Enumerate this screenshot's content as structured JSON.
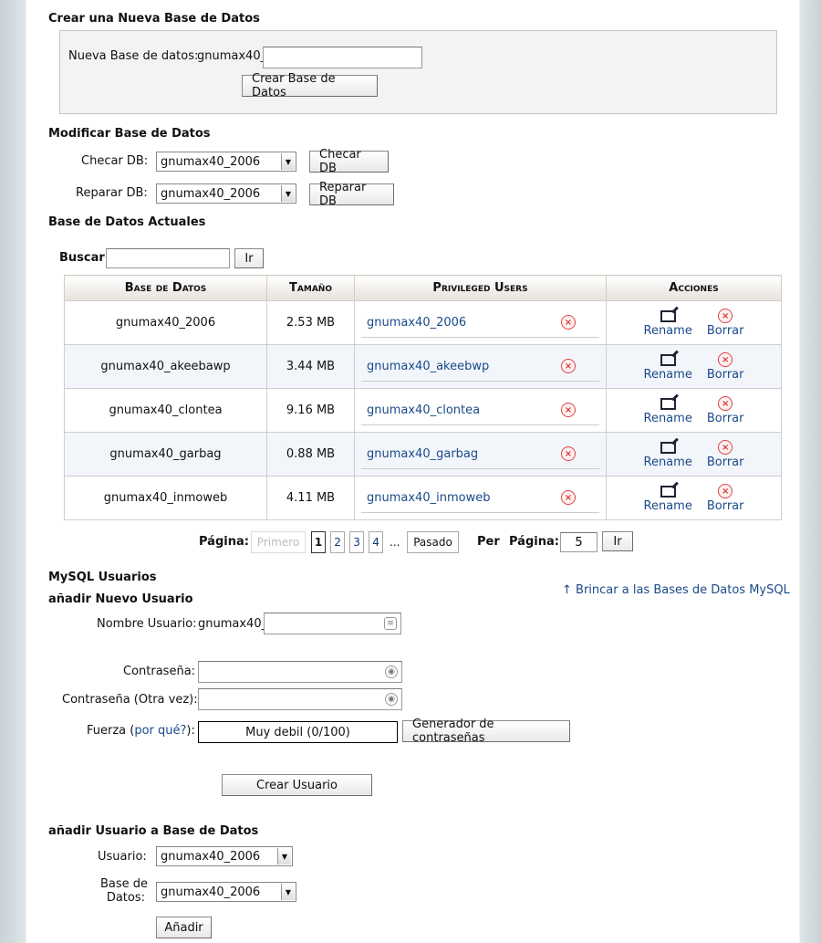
{
  "create": {
    "title": "Crear una Nueva Base de Datos",
    "label": "Nueva Base de datos:",
    "prefix": "gnumax40_",
    "input_value": "",
    "button": "Crear Base de Datos"
  },
  "modify": {
    "title": "Modificar Base de Datos",
    "check_label": "Checar DB:",
    "check_value": "gnumax40_2006",
    "check_button": "Checar DB",
    "repair_label": "Reparar DB:",
    "repair_value": "gnumax40_2006",
    "repair_button": "Reparar DB"
  },
  "current": {
    "title": "Base de Datos Actuales",
    "search_label": "Buscar",
    "search_value": "",
    "search_button": "Ir",
    "columns": [
      "Base de Datos",
      "Tamaño",
      "Privileged Users",
      "Acciones"
    ],
    "rows": [
      {
        "name": "gnumax40_2006",
        "size": "2.53 MB",
        "user": "gnumax40_2006"
      },
      {
        "name": "gnumax40_akeebawp",
        "size": "3.44 MB",
        "user": "gnumax40_akeebwp"
      },
      {
        "name": "gnumax40_clontea",
        "size": "9.16 MB",
        "user": "gnumax40_clontea"
      },
      {
        "name": "gnumax40_garbag",
        "size": "0.88 MB",
        "user": "gnumax40_garbag"
      },
      {
        "name": "gnumax40_inmoweb",
        "size": "4.11 MB",
        "user": "gnumax40_inmoweb"
      }
    ],
    "rename_label": "Rename",
    "delete_label": "Borrar",
    "x_glyph": "×"
  },
  "pagination": {
    "page_label": "Página:",
    "first": "Primero",
    "pages": [
      "1",
      "2",
      "3",
      "4"
    ],
    "ellipsis": "...",
    "last": "Pasado",
    "per_label": "Per",
    "per_page_label": "Página:",
    "per_value": "5",
    "go": "Ir"
  },
  "users": {
    "title": "MySQL Usuarios",
    "jump_link": "Brincar a las Bases de Datos MySQL",
    "add_title": "añadir Nuevo Usuario",
    "username_label": "Nombre Usuario:",
    "prefix": "gnumax40_",
    "password_label": "Contraseña:",
    "password_again_label": "Contraseña (Otra vez):",
    "strength_label_pre": "Fuerza (",
    "strength_link": "por qué?",
    "strength_label_post": "):",
    "strength_value": "Muy debil (0/100)",
    "generator_button": "Generador de contraseñas",
    "create_button": "Crear Usuario"
  },
  "add_to_db": {
    "title": "añadir Usuario a Base de Datos",
    "user_label": "Usuario:",
    "user_value": "gnumax40_2006",
    "db_label_1": "Base de",
    "db_label_2": "Datos:",
    "db_value": "gnumax40_2006",
    "button": "Añadir"
  },
  "icons": {
    "select_arrow": "▼",
    "up_arrow": "↑",
    "user_field_icon": "≡",
    "password_icon": "◉"
  }
}
